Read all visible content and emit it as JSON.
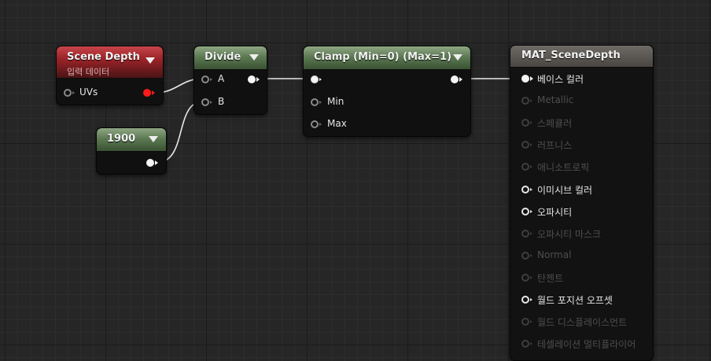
{
  "nodes": {
    "scene_depth": {
      "title": "Scene Depth",
      "subtitle": "입력 데이터",
      "uvs_label": "UVs"
    },
    "divide": {
      "title": "Divide",
      "a_label": "A",
      "b_label": "B"
    },
    "constant": {
      "value": "1900"
    },
    "clamp": {
      "title": "Clamp (Min=0) (Max=1)",
      "min_label": "Min",
      "max_label": "Max"
    },
    "material": {
      "title": "MAT_SceneDepth",
      "inputs": [
        {
          "label": "베이스 컬러",
          "active": true,
          "connected": true
        },
        {
          "label": "Metallic",
          "active": false
        },
        {
          "label": "스페큘러",
          "active": false
        },
        {
          "label": "러프니스",
          "active": false
        },
        {
          "label": "애니소트로픽",
          "active": false
        },
        {
          "label": "이미시브 컬러",
          "active": true
        },
        {
          "label": "오파시티",
          "active": true
        },
        {
          "label": "오파시티 마스크",
          "active": false
        },
        {
          "label": "Normal",
          "active": false
        },
        {
          "label": "탄젠트",
          "active": false
        },
        {
          "label": "월드 포지션 오프셋",
          "active": true
        },
        {
          "label": "월드 디스플레이스먼트",
          "active": false
        },
        {
          "label": "테셀레이션 멀티플라이어",
          "active": false
        }
      ]
    }
  },
  "colors": {
    "wire": "#e8e8e8",
    "uv_pin": "#ff1a1a"
  }
}
